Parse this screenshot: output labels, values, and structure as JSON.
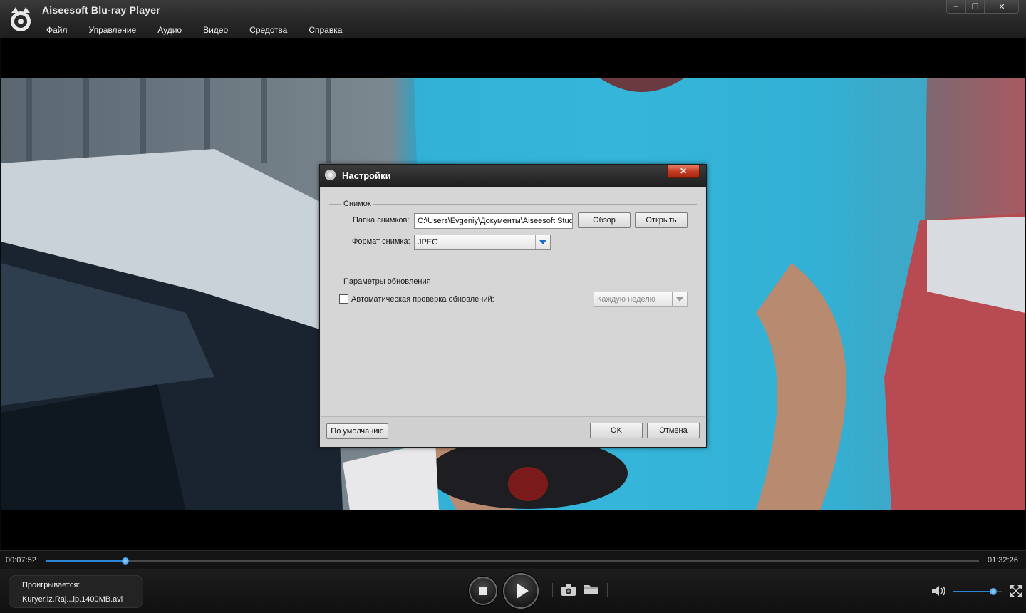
{
  "app": {
    "title": "Aiseesoft Blu-ray Player",
    "menu": [
      "Файл",
      "Управление",
      "Аудио",
      "Видео",
      "Средства",
      "Справка"
    ],
    "window_controls": {
      "minimize": "–",
      "restore": "❐",
      "close": "✕"
    }
  },
  "player": {
    "current_time": "00:07:52",
    "total_time": "01:32:26",
    "progress_fraction": 0.0852,
    "volume_fraction": 0.82,
    "now_playing_label": "Проигрывается:",
    "now_playing_file": "Kuryer.iz.Raj...ip.1400MB.avi",
    "accent_color": "#2a86d4"
  },
  "dialog": {
    "title": "Настройки",
    "close": "✕",
    "snapshot_group": "Снимок",
    "folder_label": "Папка снимков:",
    "folder_value": "C:\\Users\\Evgeniy\\Документы\\Aiseesoft Studio",
    "browse_button": "Обзор",
    "open_button": "Открыть",
    "format_label": "Формат снимка:",
    "format_value": "JPEG",
    "update_group": "Параметры обновления",
    "auto_update_label": "Автоматическая проверка обновлений:",
    "auto_update_checked": false,
    "update_frequency": "Каждую неделю",
    "default_button": "По умолчанию",
    "ok_button": "OK",
    "cancel_button": "Отмена"
  }
}
